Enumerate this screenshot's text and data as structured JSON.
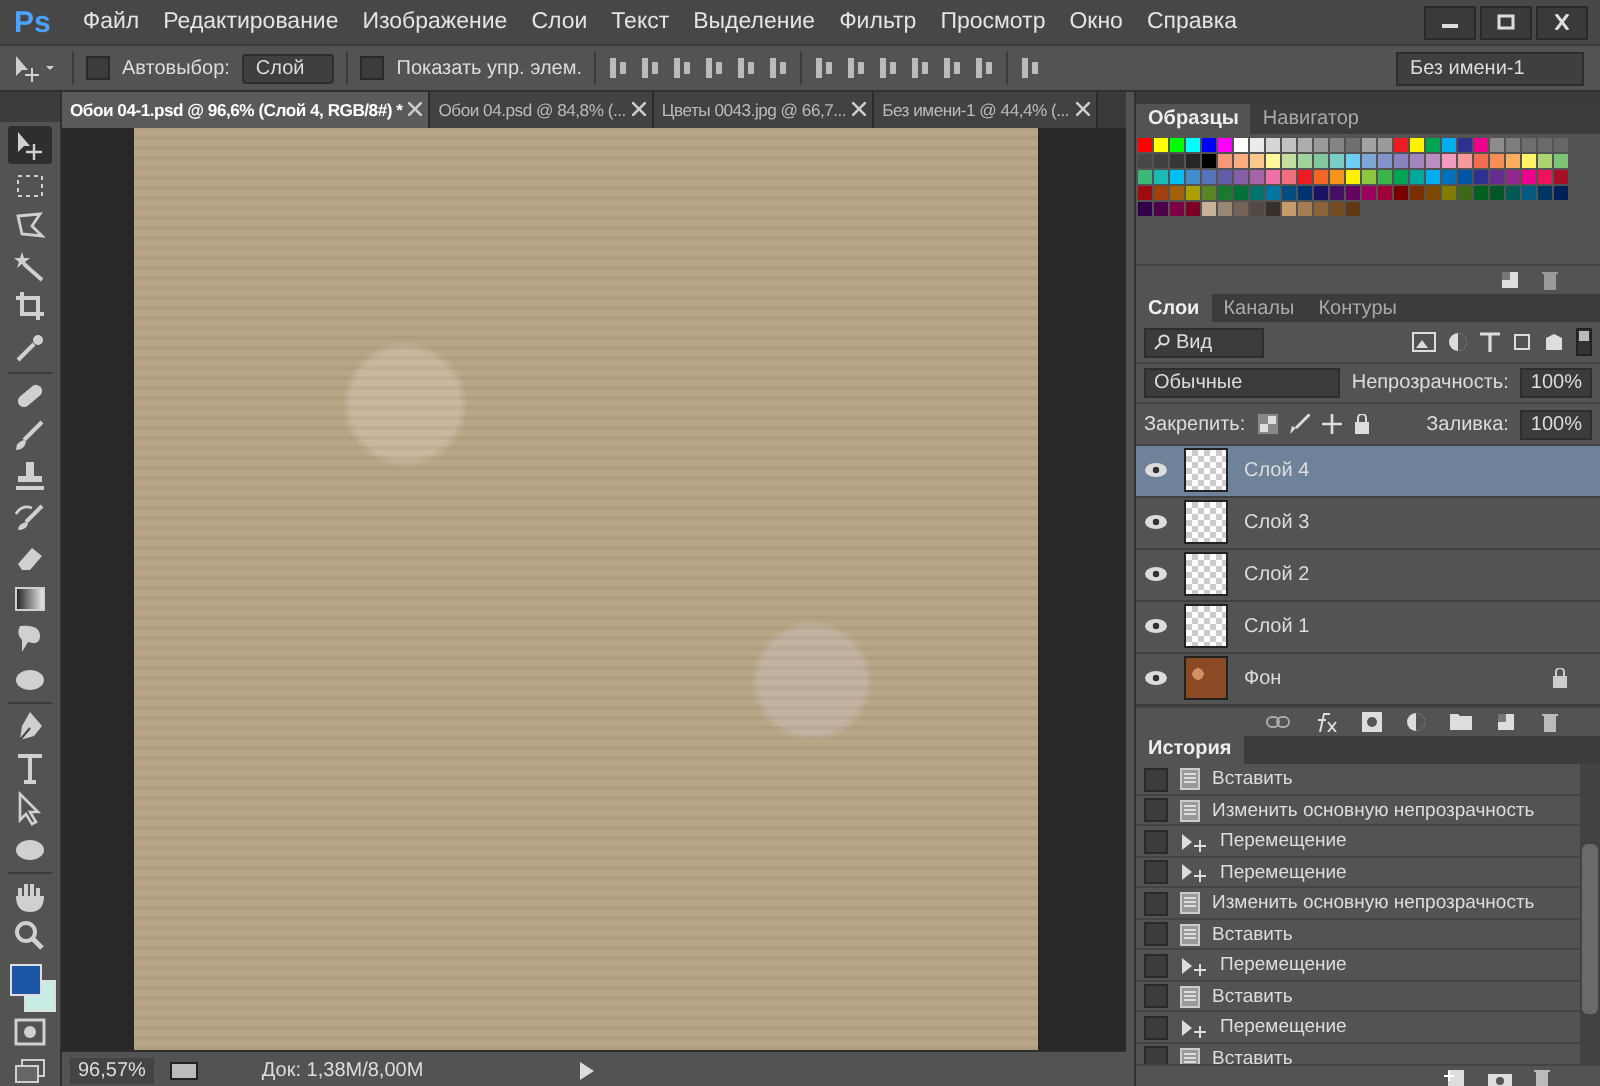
{
  "app_logo": "Ps",
  "menu": [
    "Файл",
    "Редактирование",
    "Изображение",
    "Слои",
    "Текст",
    "Выделение",
    "Фильтр",
    "Просмотр",
    "Окно",
    "Справка"
  ],
  "options_bar": {
    "auto_select": {
      "label": "Автовыбор:",
      "checked": false
    },
    "target": "Слой",
    "show_controls": {
      "label": "Показать упр. элем.",
      "checked": false
    },
    "workspace": "Без имени-1"
  },
  "document_tabs": [
    {
      "label": "Обои 04-1.psd @ 96,6% (Слой 4, RGB/8#) *",
      "selected": true
    },
    {
      "label": "Обои 04.psd @ 84,8% (...",
      "selected": false
    },
    {
      "label": "Цветы 0043.jpg @ 66,7...",
      "selected": false
    },
    {
      "label": "Без имени-1 @ 44,4% (...",
      "selected": false
    }
  ],
  "tools": [
    {
      "selected": true
    },
    {
      "selected": false
    },
    {
      "selected": false
    },
    {
      "selected": false
    },
    {
      "selected": false
    },
    {
      "selected": false
    },
    {
      "selected": false
    },
    {
      "selected": false
    },
    {
      "selected": false
    },
    {
      "selected": false
    },
    {
      "selected": false
    },
    {
      "selected": false
    },
    {
      "selected": false
    },
    {
      "selected": false
    },
    {
      "selected": false
    },
    {
      "selected": false
    },
    {
      "selected": false
    },
    {
      "selected": false
    },
    {
      "selected": false
    },
    {
      "selected": false
    }
  ],
  "colors": [
    {
      "kind": "foreground",
      "color": "#1d56a5"
    },
    {
      "kind": "background",
      "color": "#c8ebe6"
    }
  ],
  "status_bar": {
    "zoom": "96,57%",
    "doc_size": "Док: 1,38M/8,00M"
  },
  "swatches_panel": {
    "tabs": [
      {
        "label": "Образцы",
        "selected": true
      },
      {
        "label": "Навигатор",
        "selected": false
      }
    ],
    "rows": [
      [
        {
          "color": "#ff0000"
        },
        {
          "color": "#ffff00"
        },
        {
          "color": "#00ff00"
        },
        {
          "color": "#00ffff"
        },
        {
          "color": "#0000ff"
        },
        {
          "color": "#ff00ff"
        },
        {
          "color": "#ffffff"
        },
        {
          "color": "#ebebeb"
        },
        {
          "color": "#d6d6d6"
        },
        {
          "color": "#c2c2c2"
        },
        {
          "color": "#adadad"
        },
        {
          "color": "#999999"
        },
        {
          "color": "#858585"
        },
        {
          "color": "#707070"
        },
        {
          "color": "#a3a3a3"
        },
        {
          "color": "#9a9a9a"
        },
        {
          "color": "#ed1c24"
        },
        {
          "color": "#fff200"
        },
        {
          "color": "#00a651"
        },
        {
          "color": "#00aeef"
        },
        {
          "color": "#2e3192"
        },
        {
          "color": "#ec008c"
        },
        {
          "color": "#8c8c8c"
        },
        {
          "color": "#7d7d7d"
        },
        {
          "color": "#6e6e6e"
        },
        {
          "color": "#6a6a6a"
        },
        {
          "color": "#666666"
        }
      ],
      [
        {
          "color": "#474747"
        },
        {
          "color": "#404040"
        },
        {
          "color": "#363636"
        },
        {
          "color": "#262626"
        },
        {
          "color": "#000000"
        },
        {
          "color": "#f7977a"
        },
        {
          "color": "#f9ad81"
        },
        {
          "color": "#fdc68a"
        },
        {
          "color": "#fff79a"
        },
        {
          "color": "#c4df9b"
        },
        {
          "color": "#a3d39c"
        },
        {
          "color": "#82ca9d"
        },
        {
          "color": "#7bcdc8"
        },
        {
          "color": "#6ecff6"
        },
        {
          "color": "#7ea7d8"
        },
        {
          "color": "#8493ca"
        },
        {
          "color": "#8882be"
        },
        {
          "color": "#a187be"
        },
        {
          "color": "#bc8dbf"
        },
        {
          "color": "#f49ac2"
        },
        {
          "color": "#f6989d"
        },
        {
          "color": "#f26c4f"
        },
        {
          "color": "#f68e55"
        },
        {
          "color": "#fbaf5d"
        },
        {
          "color": "#fff467"
        },
        {
          "color": "#acd372"
        },
        {
          "color": "#7cc576"
        }
      ],
      [
        {
          "color": "#3bb878"
        },
        {
          "color": "#1abbb4"
        },
        {
          "color": "#00bff3"
        },
        {
          "color": "#438ccb"
        },
        {
          "color": "#5574b9"
        },
        {
          "color": "#605ca8"
        },
        {
          "color": "#855fa8"
        },
        {
          "color": "#a763a8"
        },
        {
          "color": "#f06eaa"
        },
        {
          "color": "#f26d7d"
        },
        {
          "color": "#ed1c24"
        },
        {
          "color": "#f26522"
        },
        {
          "color": "#f7941d"
        },
        {
          "color": "#fff200"
        },
        {
          "color": "#8dc73f"
        },
        {
          "color": "#39b54a"
        },
        {
          "color": "#00a651"
        },
        {
          "color": "#00a99d"
        },
        {
          "color": "#00aeef"
        },
        {
          "color": "#0072bc"
        },
        {
          "color": "#0054a6"
        },
        {
          "color": "#2e3192"
        },
        {
          "color": "#662d91"
        },
        {
          "color": "#92278f"
        },
        {
          "color": "#ec008c"
        },
        {
          "color": "#ed145b"
        },
        {
          "color": "#a50f25"
        }
      ],
      [
        {
          "color": "#9e0b0f"
        },
        {
          "color": "#a0410d"
        },
        {
          "color": "#a36209"
        },
        {
          "color": "#aba000"
        },
        {
          "color": "#598527"
        },
        {
          "color": "#1a7b30"
        },
        {
          "color": "#007236"
        },
        {
          "color": "#00746b"
        },
        {
          "color": "#0076a3"
        },
        {
          "color": "#004b80"
        },
        {
          "color": "#003471"
        },
        {
          "color": "#1b1464"
        },
        {
          "color": "#440e62"
        },
        {
          "color": "#630460"
        },
        {
          "color": "#9e005d"
        },
        {
          "color": "#9e0039"
        },
        {
          "color": "#790000"
        },
        {
          "color": "#7b2e00"
        },
        {
          "color": "#7d4900"
        },
        {
          "color": "#827b00"
        },
        {
          "color": "#406618"
        },
        {
          "color": "#005e20"
        },
        {
          "color": "#005826"
        },
        {
          "color": "#005952"
        },
        {
          "color": "#005b7f"
        },
        {
          "color": "#003663"
        },
        {
          "color": "#002157"
        }
      ],
      [
        {
          "color": "#32004b"
        },
        {
          "color": "#4b0049"
        },
        {
          "color": "#7b0046"
        },
        {
          "color": "#7a0026"
        },
        {
          "color": "#c7b299"
        },
        {
          "color": "#998675"
        },
        {
          "color": "#736357"
        },
        {
          "color": "#534741"
        },
        {
          "color": "#372f2a"
        },
        {
          "color": "#c69c6d"
        },
        {
          "color": "#a67c52"
        },
        {
          "color": "#8c6239"
        },
        {
          "color": "#754c24"
        },
        {
          "color": "#603913"
        }
      ]
    ]
  },
  "layers_panel": {
    "tabs": [
      {
        "label": "Слои",
        "selected": true
      },
      {
        "label": "Каналы",
        "selected": false
      },
      {
        "label": "Контуры",
        "selected": false
      }
    ],
    "filter": "Вид",
    "blend_mode": "Обычные",
    "opacity_label": "Непрозрачность:",
    "opacity": "100%",
    "lock_label": "Закрепить:",
    "fill_label": "Заливка:",
    "fill": "100%",
    "layers": [
      {
        "name": "Слой 4",
        "kind": "transparent",
        "visible": true,
        "selected": true,
        "locked": false
      },
      {
        "name": "Слой 3",
        "kind": "transparent",
        "visible": true,
        "selected": false,
        "locked": false
      },
      {
        "name": "Слой 2",
        "kind": "transparent",
        "visible": true,
        "selected": false,
        "locked": false
      },
      {
        "name": "Слой 1",
        "kind": "transparent",
        "visible": true,
        "selected": false,
        "locked": false
      },
      {
        "name": "Фон",
        "kind": "background",
        "visible": true,
        "selected": false,
        "locked": true
      }
    ]
  },
  "history_panel": {
    "title": "История",
    "steps": [
      {
        "kind": "document",
        "label": "Вставить",
        "checked": false
      },
      {
        "kind": "document",
        "label": "Изменить основную непрозрачность",
        "checked": false
      },
      {
        "kind": "move",
        "label": "Перемещение",
        "checked": false
      },
      {
        "kind": "move",
        "label": "Перемещение",
        "checked": false
      },
      {
        "kind": "document",
        "label": "Изменить основную непрозрачность",
        "checked": false
      },
      {
        "kind": "document",
        "label": "Вставить",
        "checked": false
      },
      {
        "kind": "move",
        "label": "Перемещение",
        "checked": false
      },
      {
        "kind": "document",
        "label": "Вставить",
        "checked": false
      },
      {
        "kind": "move",
        "label": "Перемещение",
        "checked": false
      },
      {
        "kind": "document",
        "label": "Вставить",
        "checked": false
      }
    ]
  }
}
